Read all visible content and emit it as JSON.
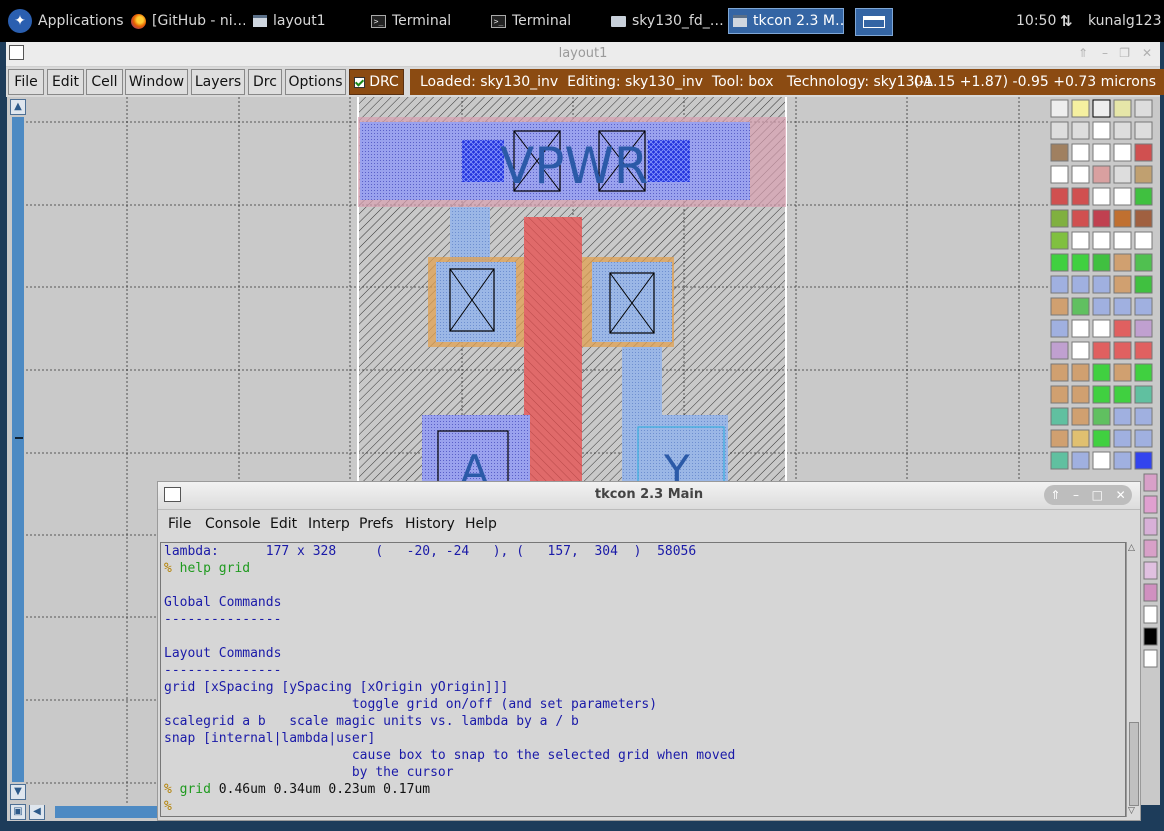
{
  "taskbar": {
    "apps_label": "Applications",
    "items": [
      {
        "label": "[GitHub - ni…",
        "icon": "firefox-icon"
      },
      {
        "label": "layout1",
        "icon": "window-icon"
      },
      {
        "label": "Terminal",
        "icon": "terminal-icon"
      },
      {
        "label": "Terminal",
        "icon": "terminal-icon"
      },
      {
        "label": "sky130_fd_…",
        "icon": "folder-icon"
      },
      {
        "label": "tkcon 2.3 M…",
        "icon": "window-icon"
      }
    ],
    "clock": "10:50",
    "user": "kunalg123"
  },
  "magic": {
    "title": "layout1",
    "menu": [
      "File",
      "Edit",
      "Cell",
      "Window",
      "Layers",
      "Drc",
      "Options"
    ],
    "drc_label": "DRC",
    "status": "Loaded: sky130_inv  Editing: sky130_inv  Tool: box   Technology: sky130A",
    "coords": "(-1.15 +1.87) -0.95 +0.73 microns",
    "layout_label_top": "VPWR",
    "layout_label_a": "A",
    "layout_label_y": "Y"
  },
  "tkcon": {
    "title": "tkcon 2.3 Main",
    "menu": [
      "File",
      "Console",
      "Edit",
      "Interp",
      "Prefs",
      "History",
      "Help"
    ],
    "lines": {
      "l1": "lambda:      177 x 328     (   -20, -24   ), (   157,  304  )  58056",
      "l2_prompt": "%",
      "l2_cmd": "help grid",
      "l4": "Global Commands",
      "l5": "---------------",
      "l7": "Layout Commands",
      "l8": "---------------",
      "l9": "grid [xSpacing [ySpacing [xOrigin yOrigin]]]",
      "l10": "                        toggle grid on/off (and set parameters)",
      "l11": "scalegrid a b   scale magic units vs. lambda by a / b",
      "l12": "snap [internal|lambda|user]",
      "l13": "                        cause box to snap to the selected grid when moved",
      "l14": "                        by the cursor",
      "l15_prompt": "%",
      "l15_cmd": "grid",
      "l15_args": " 0.46um 0.34um 0.23um 0.17um",
      "l16_prompt": "%"
    }
  },
  "colors": {
    "status_bg": "#8b4b12",
    "scroll_blue": "#4d8ac3",
    "active_task": "#3465a4",
    "console_blue": "#1a1aa8",
    "console_green": "#1f9a1f"
  }
}
